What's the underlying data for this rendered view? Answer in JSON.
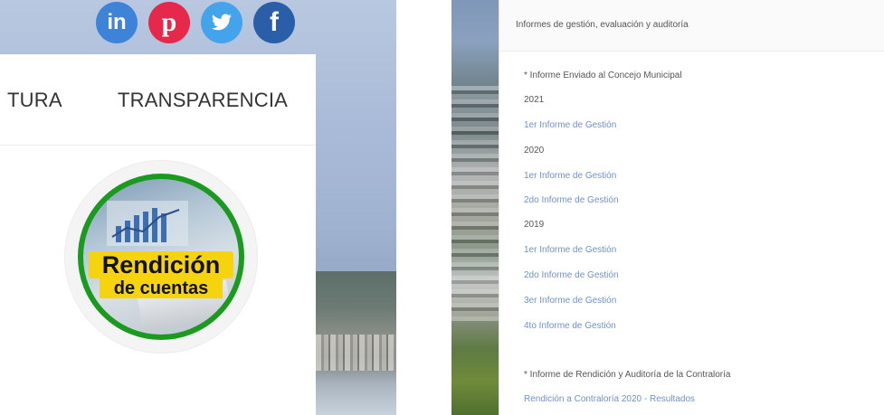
{
  "social": [
    {
      "icon": "linkedin-icon",
      "label": "in",
      "color": "#3d84d9"
    },
    {
      "icon": "pinterest-icon",
      "label": "p",
      "color": "#e6284a"
    },
    {
      "icon": "twitter-icon",
      "label": "",
      "color": "#43a4ec"
    },
    {
      "icon": "facebook-icon",
      "label": "f",
      "color": "#2a5ea9"
    }
  ],
  "nav": {
    "cultura": "TURA",
    "transparencia": "TRANSPARENCIA"
  },
  "badge": {
    "line1": "Rendición",
    "line2": "de cuentas",
    "ring_color": "#1a9a1e",
    "text_bg": "#f5d40f"
  },
  "report": {
    "header": "Informes de gestión, evaluación y auditoría",
    "section1_title": "* Informe Enviado al Concejo Municipal",
    "y2021": "2021",
    "y2021_links": [
      "1er Informe de Gestión"
    ],
    "y2020": "2020",
    "y2020_links": [
      "1er Informe de Gestión",
      "2do Informe de Gestión"
    ],
    "y2019": "2019",
    "y2019_links": [
      "1er Informe de Gestión",
      "2do Informe de Gestión",
      "3er Informe de Gestión",
      "4to Informe de Gestión"
    ],
    "section2_title": "* Informe de Rendición y Auditoría de la Contraloría",
    "section2_link": "Rendición a Contraloría 2020 - Resultados",
    "link_color": "#6e92c8"
  }
}
